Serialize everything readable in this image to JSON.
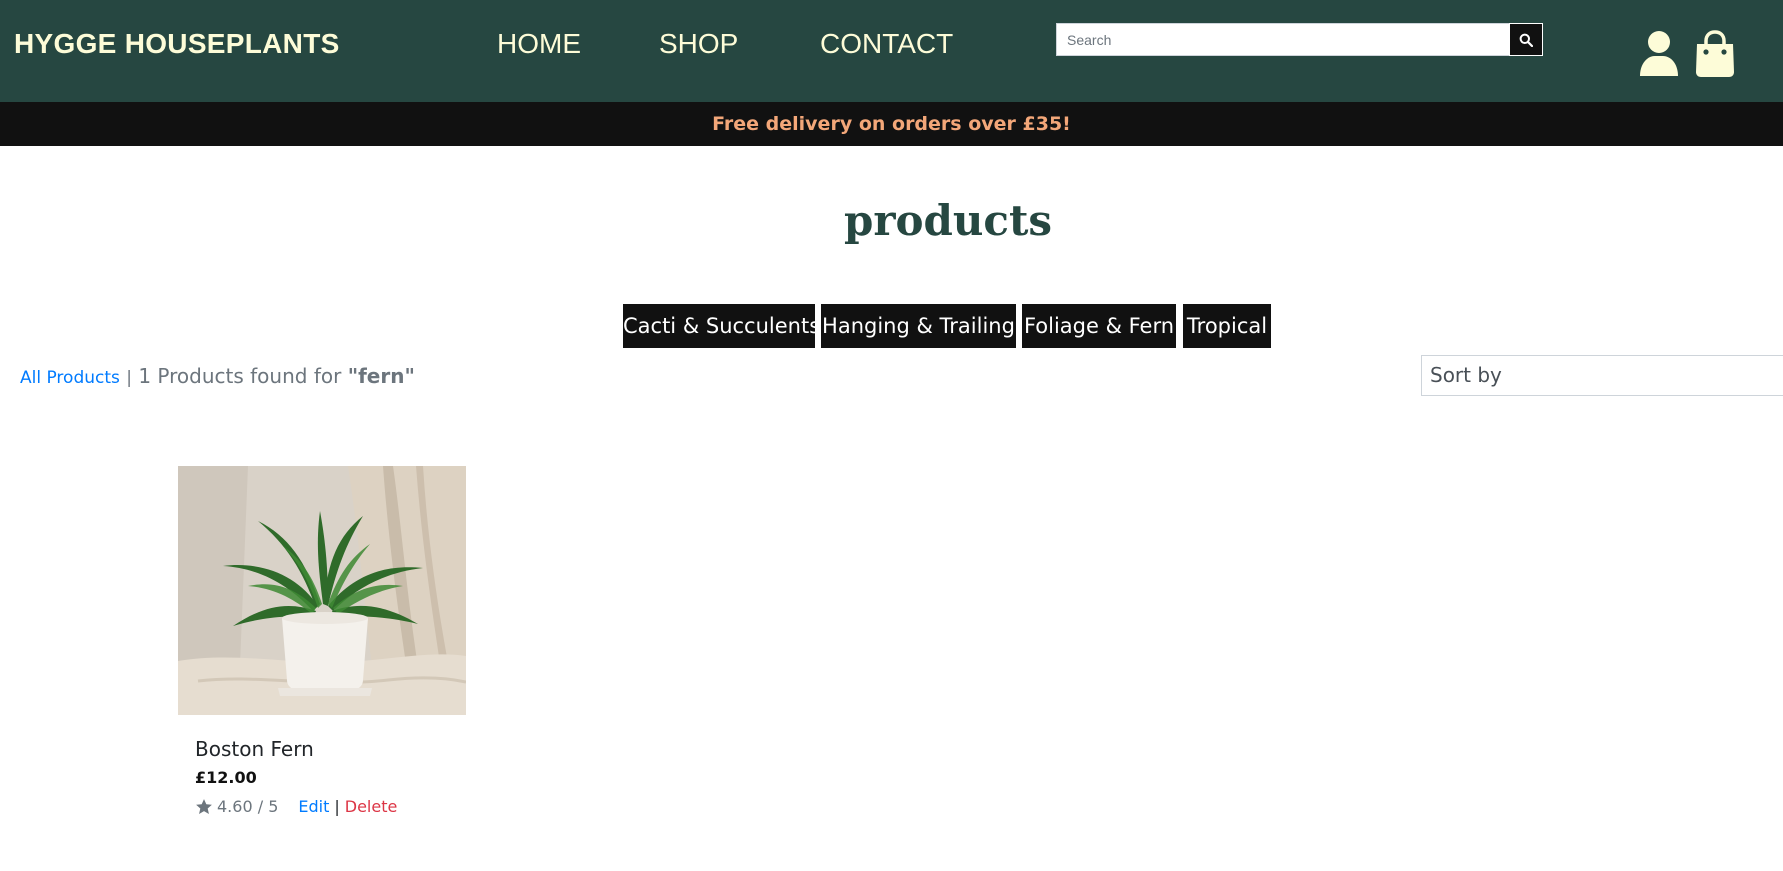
{
  "header": {
    "brand": "HYGGE HOUSEPLANTS",
    "nav": {
      "home": "HOME",
      "shop": "SHOP",
      "contact": "CONTACT"
    },
    "search": {
      "placeholder": "Search",
      "value": ""
    },
    "icons": {
      "search": "search-icon",
      "account": "user-icon",
      "bag": "shopping-bag-icon"
    }
  },
  "banner": {
    "text": "Free delivery on orders over £35!"
  },
  "page": {
    "title": "products"
  },
  "categories": [
    "Cacti & Succulents",
    "Hanging & Trailing",
    "Foliage & Fern",
    "Tropical"
  ],
  "results": {
    "all_products_link": "All Products",
    "separator": "|",
    "count_text": "1 Products found for",
    "search_term": "\"fern\""
  },
  "sort": {
    "selected": "Sort by"
  },
  "products": [
    {
      "name": "Boston Fern",
      "price": "£12.00",
      "rating": "4.60 / 5",
      "edit_label": "Edit",
      "separator": "|",
      "delete_label": "Delete"
    }
  ],
  "colors": {
    "header_bg": "#264741",
    "header_text": "#fdfcd8",
    "banner_bg": "#111111",
    "banner_text": "#f3a779",
    "title": "#264741",
    "category_bg": "#111111",
    "link": "#007bff",
    "delete": "#dc3545"
  }
}
